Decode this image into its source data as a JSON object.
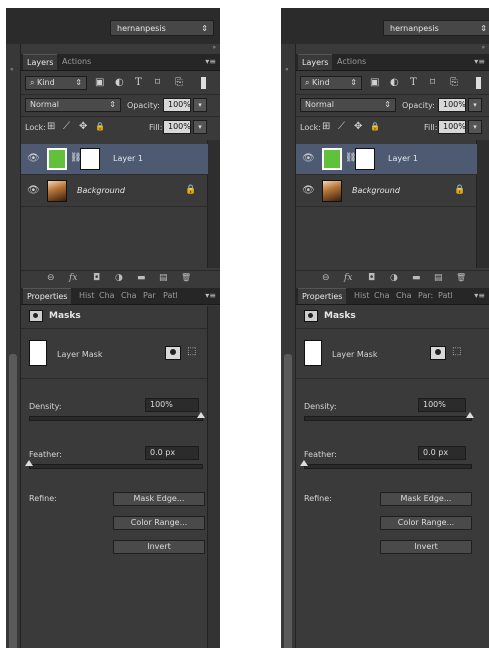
{
  "workspace": {
    "label": "hernanpesis",
    "arrow": "⇕"
  },
  "panel_header": {
    "collapse_glyph": "«",
    "pin_glyph": "»"
  },
  "layers_tabs": [
    {
      "label": "Layers"
    },
    {
      "label": "Actions"
    }
  ],
  "layers_menu": "▾≡",
  "filter": {
    "label": "Kind",
    "search_glyph": "⌕",
    "arrows": "⇕",
    "icons": [
      {
        "name": "image-filter-icon",
        "glyph": "▣"
      },
      {
        "name": "adjustment-filter-icon",
        "glyph": "◐"
      },
      {
        "name": "type-filter-icon",
        "glyph": "T"
      },
      {
        "name": "shape-filter-icon",
        "glyph": "⌑"
      },
      {
        "name": "smart-object-filter-icon",
        "glyph": "⎘"
      }
    ]
  },
  "blend": {
    "mode": "Normal",
    "arrows": "⇕",
    "opacity_label": "Opacity:",
    "opacity_value": "100%",
    "drop": "▾"
  },
  "lock": {
    "label": "Lock:",
    "icons": [
      {
        "name": "lock-transparent-icon",
        "glyph": "⊞"
      },
      {
        "name": "lock-paint-icon",
        "glyph": "⟋"
      },
      {
        "name": "lock-position-icon",
        "glyph": "✥"
      },
      {
        "name": "lock-all-icon",
        "glyph": "🔒"
      }
    ],
    "fill_label": "Fill:",
    "fill_value": "100%",
    "drop": "▾"
  },
  "layers": [
    {
      "name": "Layer 1",
      "eye": "👁",
      "link": "⛓",
      "selected": true
    },
    {
      "name": "Background",
      "eye": "👁",
      "lock": "🔒",
      "selected": false
    }
  ],
  "layer_footer": {
    "icons": [
      {
        "name": "link-layers-icon",
        "glyph": "⊖"
      },
      {
        "name": "fx-icon",
        "glyph": "fx"
      },
      {
        "name": "add-mask-icon",
        "glyph": "◘"
      },
      {
        "name": "adjustment-layer-icon",
        "glyph": "◑"
      },
      {
        "name": "folder-icon",
        "glyph": "▬"
      },
      {
        "name": "new-layer-icon",
        "glyph": "▤"
      },
      {
        "name": "trash-icon",
        "glyph": "🗑"
      }
    ]
  },
  "props_tabs_left": [
    {
      "label": "Properties"
    },
    {
      "label": "Hist"
    },
    {
      "label": "Cha"
    },
    {
      "label": "Cha"
    },
    {
      "label": "Par"
    },
    {
      "label": "Patl"
    }
  ],
  "props_tabs_right": [
    {
      "label": "Properties"
    },
    {
      "label": "Hist"
    },
    {
      "label": "Cha"
    },
    {
      "label": "Cha"
    },
    {
      "label": "Par:"
    },
    {
      "label": "Patl"
    }
  ],
  "props_menu": "▾≡",
  "properties": {
    "title": "Masks",
    "mask_label": "Layer Mask",
    "vector_glyph": "⬚",
    "density_label": "Density:",
    "density_value": "100%",
    "density_level": 1.0,
    "feather_label": "Feather:",
    "feather_value": "0.0 px",
    "feather_level": 0.0,
    "refine_label": "Refine:",
    "buttons": [
      "Mask Edge...",
      "Color Range...",
      "Invert"
    ]
  }
}
